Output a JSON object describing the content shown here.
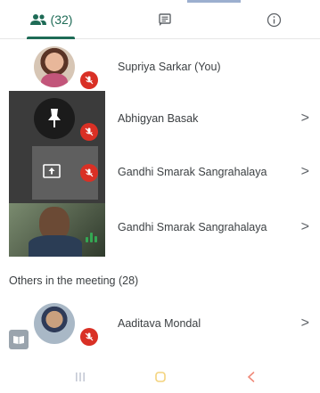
{
  "tabs": {
    "people": {
      "icon": "people-icon",
      "label": "(32)"
    },
    "chat": {
      "icon": "chat-icon"
    },
    "info": {
      "icon": "info-icon"
    }
  },
  "participants": [
    {
      "name": "Supriya Sarkar (You)",
      "muted": true
    },
    {
      "name": "Abhigyan Basak",
      "muted": true,
      "chevron": ">"
    },
    {
      "name": "Gandhi Smarak Sangrahalaya",
      "muted": true,
      "chevron": ">"
    },
    {
      "name": "Gandhi Smarak Sangrahalaya",
      "speaking": true,
      "chevron": ">"
    }
  ],
  "others": {
    "title": "Others in the meeting (28)",
    "items": [
      {
        "name": "Aaditava Mondal",
        "muted": true,
        "chevron": ">"
      }
    ]
  },
  "navbar": {
    "recents": "recents-icon",
    "home": "home-icon",
    "back": "back-icon"
  },
  "colors": {
    "accent": "#1e6b56",
    "mute": "#d93025",
    "speaking": "#34a853"
  }
}
